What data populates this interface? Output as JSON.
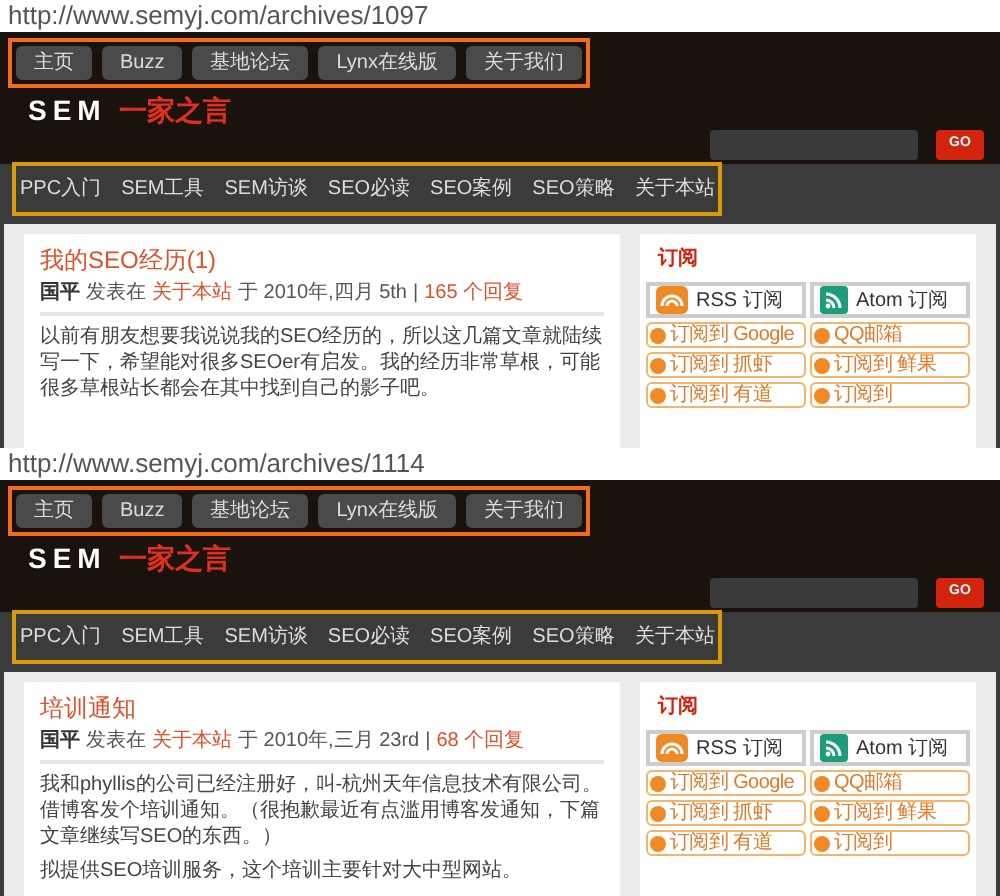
{
  "panels": [
    {
      "url": "http://www.semyj.com/archives/1097",
      "top_nav": [
        "主页",
        "Buzz",
        "基地论坛",
        "Lynx在线版",
        "关于我们"
      ],
      "logo": {
        "text": "SEM",
        "tagline": "一家之言"
      },
      "search": {
        "button": "GO"
      },
      "main_nav": [
        "PPC入门",
        "SEM工具",
        "SEM访谈",
        "SEO必读",
        "SEO案例",
        "SEO策略",
        "关于本站"
      ],
      "post": {
        "title": "我的SEO经历(1)",
        "author": "国平",
        "posted_in": "发表在",
        "category": "关于本站",
        "on_date": "于 2010年,四月 5th",
        "separator": "|",
        "comments": "165 个回复",
        "paragraphs": [
          "以前有朋友想要我说说我的SEO经历的，所以这几篇文章就陆续写一下，希望能对很多SEOer有启发。我的经历非常草根，可能很多草根站长都会在其中找到自己的影子吧。"
        ]
      },
      "sidebar": {
        "title": "订阅",
        "feeds": [
          {
            "kind": "rss",
            "label": "RSS 订阅"
          },
          {
            "kind": "atom",
            "label": "Atom 订阅"
          }
        ],
        "subscribe": [
          "订阅到 Google",
          "QQ邮箱",
          "订阅到 抓虾",
          "订阅到 鲜果",
          "订阅到 有道",
          "订阅到"
        ]
      }
    },
    {
      "url": "http://www.semyj.com/archives/1114",
      "top_nav": [
        "主页",
        "Buzz",
        "基地论坛",
        "Lynx在线版",
        "关于我们"
      ],
      "logo": {
        "text": "SEM",
        "tagline": "一家之言"
      },
      "search": {
        "button": "GO"
      },
      "main_nav": [
        "PPC入门",
        "SEM工具",
        "SEM访谈",
        "SEO必读",
        "SEO案例",
        "SEO策略",
        "关于本站"
      ],
      "post": {
        "title": "培训通知",
        "author": "国平",
        "posted_in": "发表在",
        "category": "关于本站",
        "on_date": "于 2010年,三月 23rd",
        "separator": "|",
        "comments": "68 个回复",
        "paragraphs": [
          "我和phyllis的公司已经注册好，叫-杭州天年信息技术有限公司。借博客发个培训通知。（很抱歉最近有点滥用博客发通知，下篇文章继续写SEO的东西。）",
          "拟提供SEO培训服务，这个培训主要针对大中型网站。"
        ]
      },
      "sidebar": {
        "title": "订阅",
        "feeds": [
          {
            "kind": "rss",
            "label": "RSS 订阅"
          },
          {
            "kind": "atom",
            "label": "Atom 订阅"
          }
        ],
        "subscribe": [
          "订阅到 Google",
          "QQ邮箱",
          "订阅到 抓虾",
          "订阅到 鲜果",
          "订阅到 有道",
          "订阅到"
        ]
      }
    }
  ]
}
